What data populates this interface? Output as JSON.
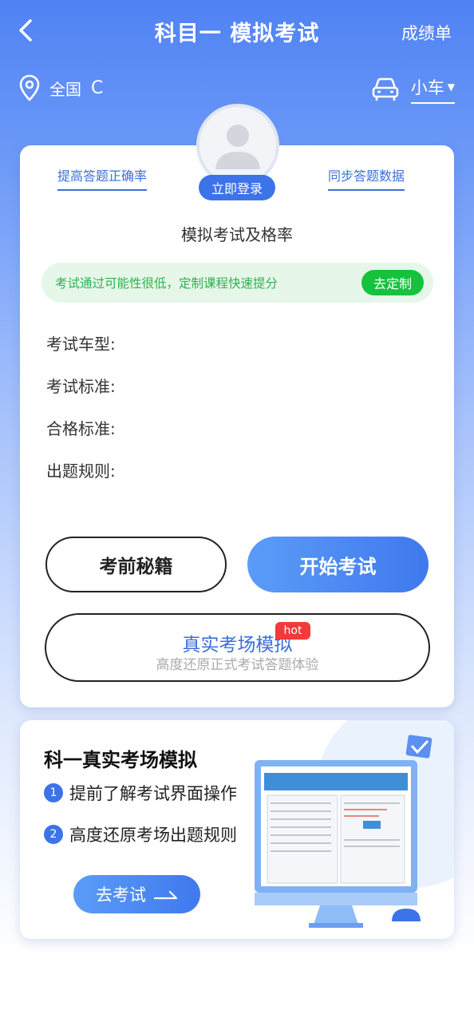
{
  "header": {
    "title": "科目一 模拟考试",
    "right_link": "成绩单"
  },
  "location": {
    "city": "全国",
    "refresh_glyph": "C"
  },
  "vehicle": {
    "label": "小车"
  },
  "profile": {
    "login_label": "立即登录",
    "link_left": "提高答题正确率",
    "link_right": "同步答题数据"
  },
  "exam": {
    "pass_rate_label": "模拟考试及格率",
    "tip_text": "考试通过可能性很低，定制课程快速提分",
    "tip_button": "去定制",
    "info_labels": [
      "考试车型:",
      "考试标准:",
      "合格标准:",
      "出题规则:"
    ],
    "tips_button": "考前秘籍",
    "start_button": "开始考试",
    "real_title": "真实考场模拟",
    "real_subtitle": "高度还原正式考试答题体验",
    "hot_badge": "hot"
  },
  "promo": {
    "title": "科一真实考场模拟",
    "items": [
      {
        "num": "1",
        "text": "提前了解考试界面操作"
      },
      {
        "num": "2",
        "text": "高度还原考场出题规则"
      }
    ],
    "button": "去考试"
  },
  "colors": {
    "primary": "#3c73e9",
    "green": "#14c23b",
    "hot": "#f23a3a"
  }
}
